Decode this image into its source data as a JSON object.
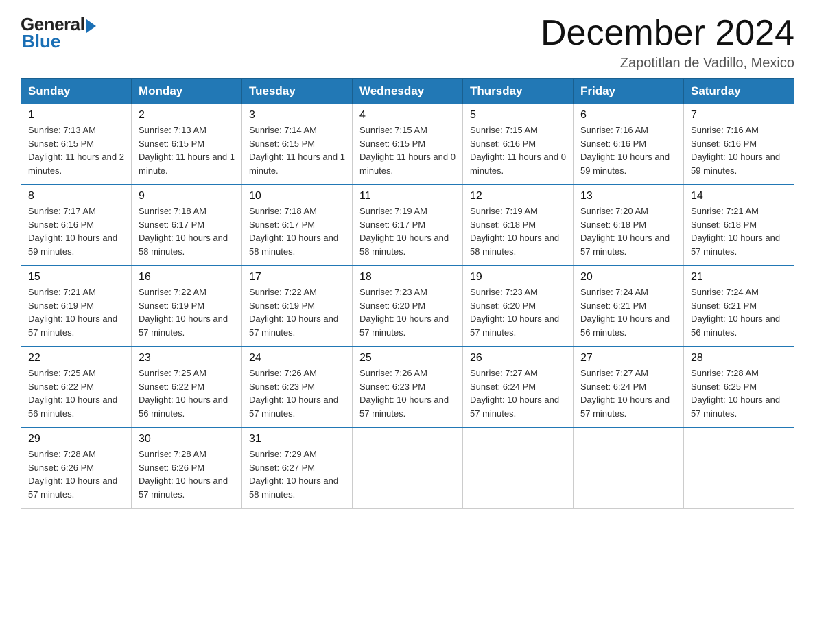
{
  "logo": {
    "general": "General",
    "blue": "Blue"
  },
  "title": "December 2024",
  "location": "Zapotitlan de Vadillo, Mexico",
  "days_of_week": [
    "Sunday",
    "Monday",
    "Tuesday",
    "Wednesday",
    "Thursday",
    "Friday",
    "Saturday"
  ],
  "weeks": [
    [
      {
        "day": "1",
        "sunrise": "7:13 AM",
        "sunset": "6:15 PM",
        "daylight": "11 hours and 2 minutes."
      },
      {
        "day": "2",
        "sunrise": "7:13 AM",
        "sunset": "6:15 PM",
        "daylight": "11 hours and 1 minute."
      },
      {
        "day": "3",
        "sunrise": "7:14 AM",
        "sunset": "6:15 PM",
        "daylight": "11 hours and 1 minute."
      },
      {
        "day": "4",
        "sunrise": "7:15 AM",
        "sunset": "6:15 PM",
        "daylight": "11 hours and 0 minutes."
      },
      {
        "day": "5",
        "sunrise": "7:15 AM",
        "sunset": "6:16 PM",
        "daylight": "11 hours and 0 minutes."
      },
      {
        "day": "6",
        "sunrise": "7:16 AM",
        "sunset": "6:16 PM",
        "daylight": "10 hours and 59 minutes."
      },
      {
        "day": "7",
        "sunrise": "7:16 AM",
        "sunset": "6:16 PM",
        "daylight": "10 hours and 59 minutes."
      }
    ],
    [
      {
        "day": "8",
        "sunrise": "7:17 AM",
        "sunset": "6:16 PM",
        "daylight": "10 hours and 59 minutes."
      },
      {
        "day": "9",
        "sunrise": "7:18 AM",
        "sunset": "6:17 PM",
        "daylight": "10 hours and 58 minutes."
      },
      {
        "day": "10",
        "sunrise": "7:18 AM",
        "sunset": "6:17 PM",
        "daylight": "10 hours and 58 minutes."
      },
      {
        "day": "11",
        "sunrise": "7:19 AM",
        "sunset": "6:17 PM",
        "daylight": "10 hours and 58 minutes."
      },
      {
        "day": "12",
        "sunrise": "7:19 AM",
        "sunset": "6:18 PM",
        "daylight": "10 hours and 58 minutes."
      },
      {
        "day": "13",
        "sunrise": "7:20 AM",
        "sunset": "6:18 PM",
        "daylight": "10 hours and 57 minutes."
      },
      {
        "day": "14",
        "sunrise": "7:21 AM",
        "sunset": "6:18 PM",
        "daylight": "10 hours and 57 minutes."
      }
    ],
    [
      {
        "day": "15",
        "sunrise": "7:21 AM",
        "sunset": "6:19 PM",
        "daylight": "10 hours and 57 minutes."
      },
      {
        "day": "16",
        "sunrise": "7:22 AM",
        "sunset": "6:19 PM",
        "daylight": "10 hours and 57 minutes."
      },
      {
        "day": "17",
        "sunrise": "7:22 AM",
        "sunset": "6:19 PM",
        "daylight": "10 hours and 57 minutes."
      },
      {
        "day": "18",
        "sunrise": "7:23 AM",
        "sunset": "6:20 PM",
        "daylight": "10 hours and 57 minutes."
      },
      {
        "day": "19",
        "sunrise": "7:23 AM",
        "sunset": "6:20 PM",
        "daylight": "10 hours and 57 minutes."
      },
      {
        "day": "20",
        "sunrise": "7:24 AM",
        "sunset": "6:21 PM",
        "daylight": "10 hours and 56 minutes."
      },
      {
        "day": "21",
        "sunrise": "7:24 AM",
        "sunset": "6:21 PM",
        "daylight": "10 hours and 56 minutes."
      }
    ],
    [
      {
        "day": "22",
        "sunrise": "7:25 AM",
        "sunset": "6:22 PM",
        "daylight": "10 hours and 56 minutes."
      },
      {
        "day": "23",
        "sunrise": "7:25 AM",
        "sunset": "6:22 PM",
        "daylight": "10 hours and 56 minutes."
      },
      {
        "day": "24",
        "sunrise": "7:26 AM",
        "sunset": "6:23 PM",
        "daylight": "10 hours and 57 minutes."
      },
      {
        "day": "25",
        "sunrise": "7:26 AM",
        "sunset": "6:23 PM",
        "daylight": "10 hours and 57 minutes."
      },
      {
        "day": "26",
        "sunrise": "7:27 AM",
        "sunset": "6:24 PM",
        "daylight": "10 hours and 57 minutes."
      },
      {
        "day": "27",
        "sunrise": "7:27 AM",
        "sunset": "6:24 PM",
        "daylight": "10 hours and 57 minutes."
      },
      {
        "day": "28",
        "sunrise": "7:28 AM",
        "sunset": "6:25 PM",
        "daylight": "10 hours and 57 minutes."
      }
    ],
    [
      {
        "day": "29",
        "sunrise": "7:28 AM",
        "sunset": "6:26 PM",
        "daylight": "10 hours and 57 minutes."
      },
      {
        "day": "30",
        "sunrise": "7:28 AM",
        "sunset": "6:26 PM",
        "daylight": "10 hours and 57 minutes."
      },
      {
        "day": "31",
        "sunrise": "7:29 AM",
        "sunset": "6:27 PM",
        "daylight": "10 hours and 58 minutes."
      },
      null,
      null,
      null,
      null
    ]
  ]
}
